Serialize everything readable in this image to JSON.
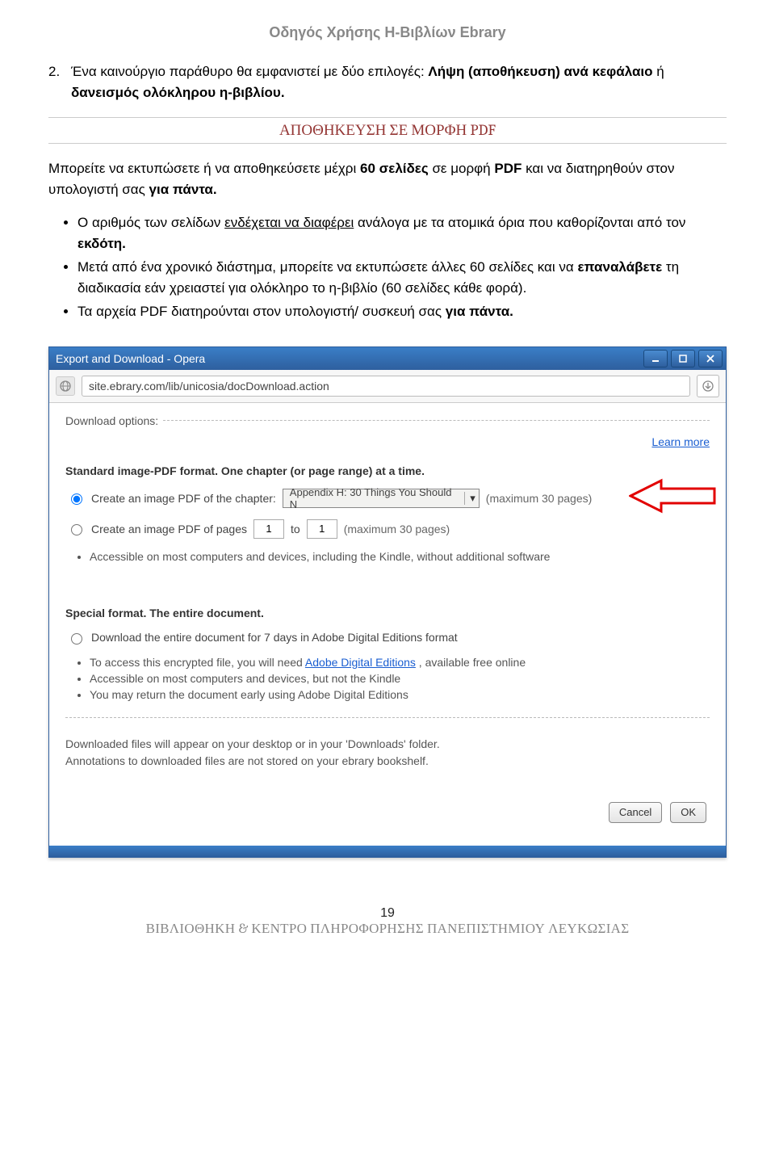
{
  "header": {
    "title": "Οδηγός Χρήσης Η-Βιβλίων Ebrary"
  },
  "item2": {
    "marker": "2.",
    "before": "Ένα καινούργιο παράθυρο θα εμφανιστεί με δύο επιλογές: ",
    "bold1": "Λήψη (αποθήκευση) ανά κεφάλαιο",
    "mid": " ή ",
    "bold2": "δανεισμός ολόκληρου η-βιβλίου.",
    "after": ""
  },
  "section_heading": "ΑΠΟΘΗΚΕΥΣΗ ΣΕ ΜΟΡΦΗ PDF",
  "para1": {
    "p1": "Μπορείτε να εκτυπώσετε ή να αποθηκεύσετε μέχρι ",
    "b1": "60 σελίδες",
    "p2": " σε μορφή ",
    "b2": "PDF",
    "p3": " και να διατηρηθούν στον υπολογιστή σας ",
    "b3": "για πάντα."
  },
  "bullets": {
    "b1": {
      "t1": "Ο αριθμός των σελίδων ",
      "u1": "ενδέχεται να διαφέρει",
      "t2": " ανάλογα με τα ατομικά όρια που καθορίζονται από τον ",
      "bold": "εκδότη."
    },
    "b2": {
      "t1": "Μετά από ένα χρονικό διάστημα, μπορείτε να εκτυπώσετε άλλες 60 σελίδες και να ",
      "bold": "επαναλάβετε",
      "t2": " τη διαδικασία εάν χρειαστεί για ολόκληρο το η-βιβλίο (60 σελίδες κάθε φορά)."
    },
    "b3": {
      "t1": "Τα αρχεία PDF διατηρούνται στον υπολογιστή/ συσκευή σας ",
      "bold": "για πάντα."
    }
  },
  "browser": {
    "title": "Export and Download - Opera",
    "url": "site.ebrary.com/lib/unicosia/docDownload.action",
    "fieldset": "Download options:",
    "learn_more": "Learn more",
    "standard_head": "Standard image-PDF format. One chapter (or page range) at a time.",
    "opt_chapter_label": "Create an image PDF of the chapter:",
    "chapter_value": "Appendix H: 30 Things You Should N",
    "chapter_note": "(maximum 30 pages)",
    "opt_pages_label": "Create an image PDF of pages",
    "page_from": "1",
    "page_to_label": "to",
    "page_to": "1",
    "pages_note": "(maximum 30 pages)",
    "std_sub1": "Accessible on most computers and devices, including the Kindle, without additional software",
    "special_head": "Special format. The entire document.",
    "opt_download_label": "Download the entire document for 7 days in Adobe Digital Editions format",
    "sp_sub1_a": "To access this encrypted file, you will need ",
    "sp_sub1_link": "Adobe Digital Editions",
    "sp_sub1_b": " , available free online",
    "sp_sub2": "Accessible on most computers and devices, but not the Kindle",
    "sp_sub3": "You may return the document early using Adobe Digital Editions",
    "note1": "Downloaded files will appear on your desktop or in your 'Downloads' folder.",
    "note2": "Annotations to downloaded files are not stored on your ebrary bookshelf.",
    "cancel": "Cancel",
    "ok": "OK"
  },
  "footer": {
    "page": "19",
    "org": "ΒΙΒΛΙΟΘΗΚΗ & ΚΕΝΤΡΟ ΠΛΗΡΟΦΟΡΗΣΗΣ ΠΑΝΕΠΙΣΤΗΜΙΟΥ ΛΕΥΚΩΣΙΑΣ"
  }
}
